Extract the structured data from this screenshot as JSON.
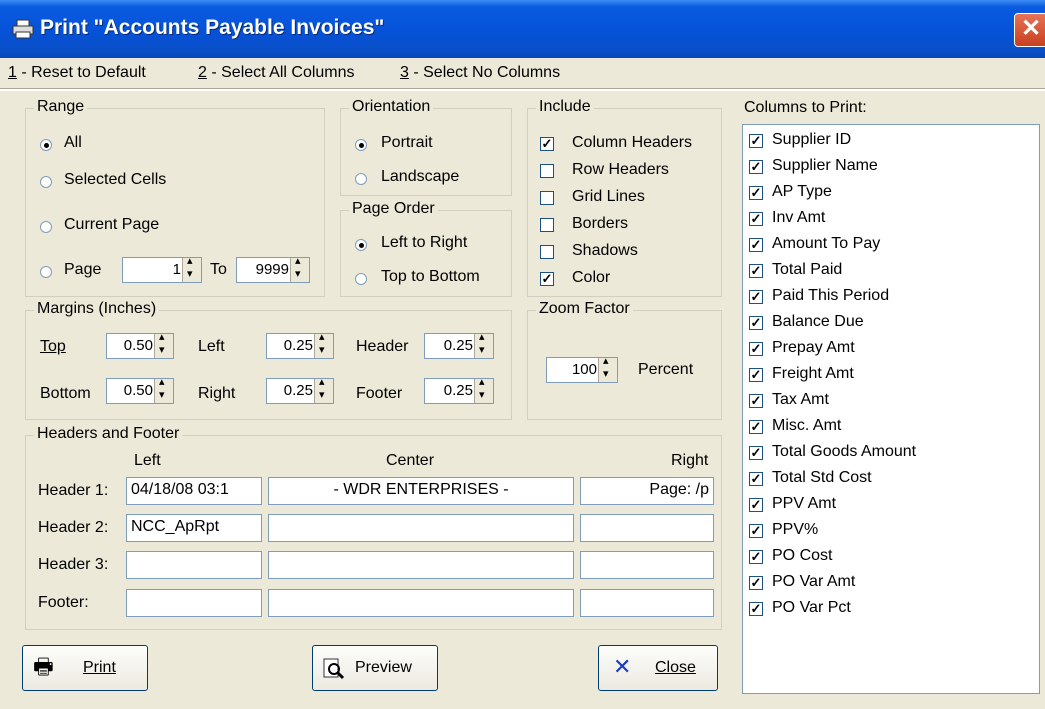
{
  "window": {
    "title": "Print \"Accounts Payable Invoices\"",
    "close_icon": "close-icon",
    "print_icon": "printer-icon"
  },
  "menu": [
    {
      "key": "1",
      "label": " - Reset to Default"
    },
    {
      "key": "2",
      "label": " - Select All Columns"
    },
    {
      "key": "3",
      "label": " - Select No Columns"
    }
  ],
  "range": {
    "title": "Range",
    "options": [
      "All",
      "Selected Cells",
      "Current Page",
      "Page"
    ],
    "selected": "All",
    "page_from": "1",
    "to_label": "To",
    "page_to": "9999"
  },
  "orientation": {
    "title": "Orientation",
    "options": [
      "Portrait",
      "Landscape"
    ],
    "selected": "Portrait"
  },
  "page_order": {
    "title": "Page Order",
    "options": [
      "Left to Right",
      "Top to Bottom"
    ],
    "selected": "Left to Right"
  },
  "include": {
    "title": "Include",
    "items": [
      {
        "label": "Column Headers",
        "checked": true
      },
      {
        "label": "Row Headers",
        "checked": false
      },
      {
        "label": "Grid Lines",
        "checked": false
      },
      {
        "label": "Borders",
        "checked": false
      },
      {
        "label": "Shadows",
        "checked": false
      },
      {
        "label": "Color",
        "checked": true
      }
    ]
  },
  "margins": {
    "title": "Margins (Inches)",
    "top_label": "Top",
    "top": "0.50",
    "bottom_label": "Bottom",
    "bottom": "0.50",
    "left_label": "Left",
    "left": "0.25",
    "right_label": "Right",
    "right": "0.25",
    "header_label": "Header",
    "header": "0.25",
    "footer_label": "Footer",
    "footer": "0.25"
  },
  "zoom": {
    "title": "Zoom Factor",
    "value": "100",
    "unit": "Percent"
  },
  "headers_footer": {
    "title": "Headers and Footer",
    "col_left": "Left",
    "col_center": "Center",
    "col_right": "Right",
    "rows": [
      {
        "label": "Header 1:",
        "left": "04/18/08  03:1",
        "center": "-   WDR ENTERPRISES   -",
        "right": "Page: /p"
      },
      {
        "label": "Header 2:",
        "left": "NCC_ApRpt",
        "center": "",
        "right": ""
      },
      {
        "label": "Header 3:",
        "left": "",
        "center": "",
        "right": ""
      },
      {
        "label": "Footer:",
        "left": "",
        "center": "",
        "right": ""
      }
    ]
  },
  "buttons": {
    "print": "Print",
    "preview": "Preview",
    "close": "Close"
  },
  "columns": {
    "title": "Columns to Print:",
    "items": [
      "Supplier ID",
      "Supplier Name",
      "AP Type",
      "Inv Amt",
      "Amount To Pay",
      "Total Paid",
      "Paid This Period",
      "Balance Due",
      "Prepay Amt",
      "Freight Amt",
      "Tax Amt",
      "Misc. Amt",
      "Total Goods Amount",
      "Total Std Cost",
      "PPV Amt",
      "PPV%",
      "PO Cost",
      "PO Var Amt",
      "PO Var Pct"
    ]
  }
}
